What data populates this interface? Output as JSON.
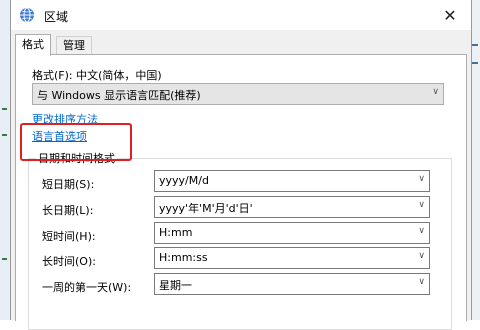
{
  "window": {
    "title": "区域",
    "close_icon": "close-icon"
  },
  "tabs": [
    {
      "label": "格式",
      "active": true
    },
    {
      "label": "管理",
      "active": false
    }
  ],
  "format": {
    "label": "格式(F): 中文(简体，中国)",
    "selected": "与 Windows 显示语言匹配(推荐)"
  },
  "links": {
    "sort": "更改排序方法",
    "language_prefs": "语言首选项"
  },
  "datetime": {
    "group_title": "日期和时间格式",
    "rows": [
      {
        "label": "短日期(S):",
        "value": "yyyy/M/d"
      },
      {
        "label": "长日期(L):",
        "value": "yyyy'年'M'月'd'日'"
      },
      {
        "label": "短时间(H):",
        "value": "H:mm"
      },
      {
        "label": "长时间(O):",
        "value": "H:mm:ss"
      },
      {
        "label": "一周的第一天(W):",
        "value": "星期一"
      }
    ]
  },
  "colors": {
    "highlight": "#e02020",
    "link": "#0066cc"
  }
}
